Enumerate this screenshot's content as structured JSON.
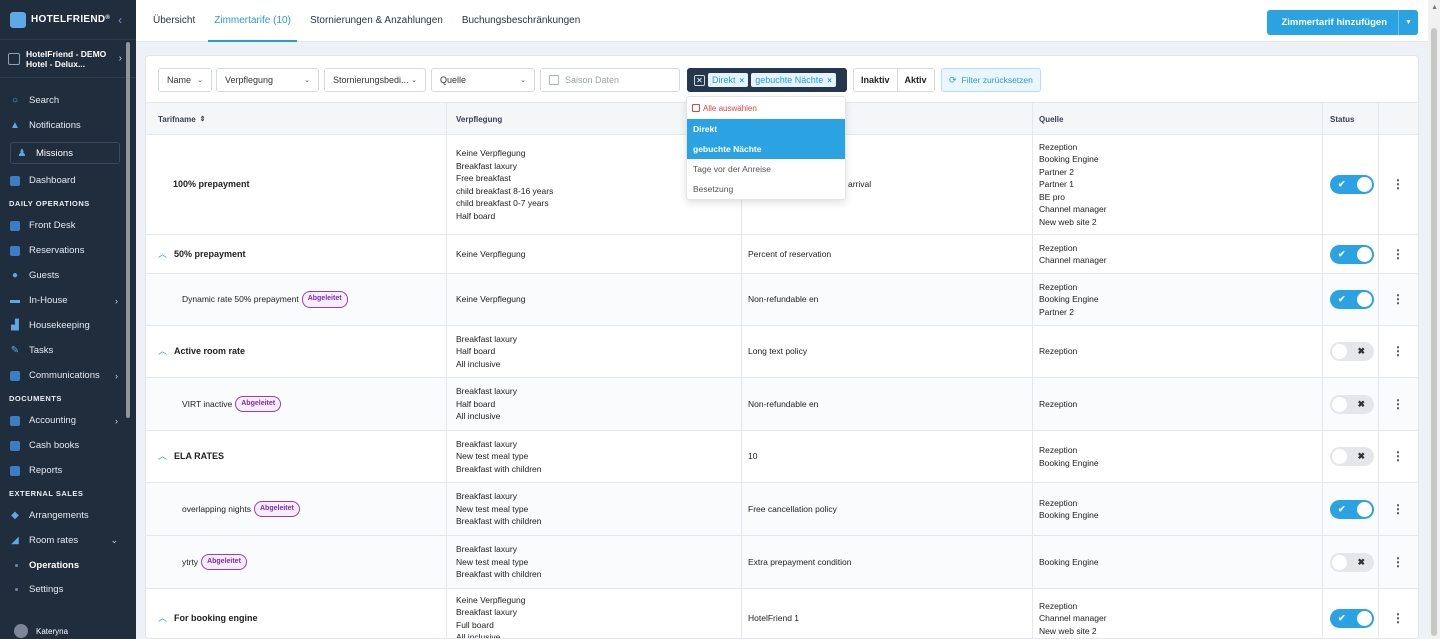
{
  "app": {
    "logo_text": "HOTELFRIEND",
    "logo_reg": "®",
    "hotel_name_line1": "HotelFriend - DEMO",
    "hotel_name_line2": "Hotel - Delux..."
  },
  "sidebar": {
    "search": "Search",
    "notifications": "Notifications",
    "missions": "Missions",
    "dashboard": "Dashboard",
    "section_daily": "DAILY OPERATIONS",
    "front_desk": "Front Desk",
    "reservations": "Reservations",
    "guests": "Guests",
    "in_house": "In-House",
    "housekeeping": "Housekeeping",
    "tasks": "Tasks",
    "communications": "Communications",
    "section_documents": "DOCUMENTS",
    "accounting": "Accounting",
    "cash_books": "Cash books",
    "reports": "Reports",
    "section_external": "EXTERNAL SALES",
    "arrangements": "Arrangements",
    "room_rates": "Room rates",
    "operations": "Operations",
    "settings": "Settings",
    "user": "Kateryna"
  },
  "tabs": {
    "overview": "Übersicht",
    "room_rates": "Zimmertarife (10)",
    "cancellations": "Stornierungen & Anzahlungen",
    "restrictions": "Buchungsbeschränkungen"
  },
  "add_button": "Zimmertarif hinzufügen",
  "filters": {
    "name": "Name",
    "meal": "Verpflegung",
    "cancellation": "Stornierungsbedi...",
    "source": "Quelle",
    "season_placeholder": "Saison Daten",
    "tag_direct": "Direkt",
    "tag_nights": "gebuchte Nächte",
    "inactive": "Inaktiv",
    "active": "Aktiv",
    "reset": "Filter zurücksetzen"
  },
  "dropdown": {
    "select_all": "Alle auswählen",
    "items": [
      "Direkt",
      "gebuchte Nächte",
      "Tage vor der Anreise",
      "Besetzung"
    ]
  },
  "table": {
    "headers": {
      "name": "Tarifname",
      "meal": "Verpflegung",
      "source": "Quelle",
      "status": "Status"
    },
    "rows": [
      {
        "name": "100% prepayment",
        "meals": "Keine Verpflegung\nBreakfast laxury\nFree breakfast\nchild breakfast 8-16 years\nchild breakfast 0-7 years\nHalf board",
        "policy": "arrival",
        "sources": "Rezeption\nBooking Engine\nPartner 2\nPartner 1\nBE pro\nChannel manager\nNew web site 2",
        "status": "on"
      },
      {
        "name": "50% prepayment",
        "meals": "Keine Verpflegung",
        "policy": "Percent of reservation",
        "sources": "Rezeption\nChannel manager",
        "status": "on"
      },
      {
        "name": "Dynamic rate 50% prepayment",
        "badge": "Abgeleitet",
        "meals": "Keine Verpflegung",
        "policy": "Non-refundable en",
        "sources": "Rezeption\nBooking Engine\nPartner 2",
        "status": "on"
      },
      {
        "name": "Active room rate",
        "meals": "Breakfast laxury\nHalf board\nAll inclusive",
        "policy": "Long text policy",
        "sources": "Rezeption",
        "status": "off"
      },
      {
        "name": "VIRT inactive",
        "badge": "Abgeleitet",
        "meals": "Breakfast laxury\nHalf board\nAll inclusive",
        "policy": "Non-refundable en",
        "sources": "Rezeption",
        "status": "off"
      },
      {
        "name": "ELA RATES",
        "meals": "Breakfast laxury\nNew test meal type\nBreakfast with children",
        "policy": "10",
        "sources": "Rezeption\nBooking Engine",
        "status": "off"
      },
      {
        "name": "overlapping nights",
        "badge": "Abgeleitet",
        "meals": "Breakfast laxury\nNew test meal type\nBreakfast with children",
        "policy": "Free cancellation policy",
        "sources": "Rezeption\nBooking Engine",
        "status": "on"
      },
      {
        "name": "ytrty",
        "badge": "Abgeleitet",
        "meals": "Breakfast laxury\nNew test meal type\nBreakfast with children",
        "policy": "Extra prepayment condition",
        "sources": "Booking Engine",
        "status": "off"
      },
      {
        "name": "For booking engine",
        "meals": "Keine Verpflegung\nBreakfast laxury\nFull board\nAll inclusive",
        "policy": "HotelFriend 1",
        "sources": "Rezeption\nChannel manager\nNew web site 2",
        "status": "on"
      }
    ]
  },
  "icons": {
    "toggle_on": "✔",
    "toggle_off": "✖",
    "kebab": "⋮",
    "expand": "︿"
  }
}
